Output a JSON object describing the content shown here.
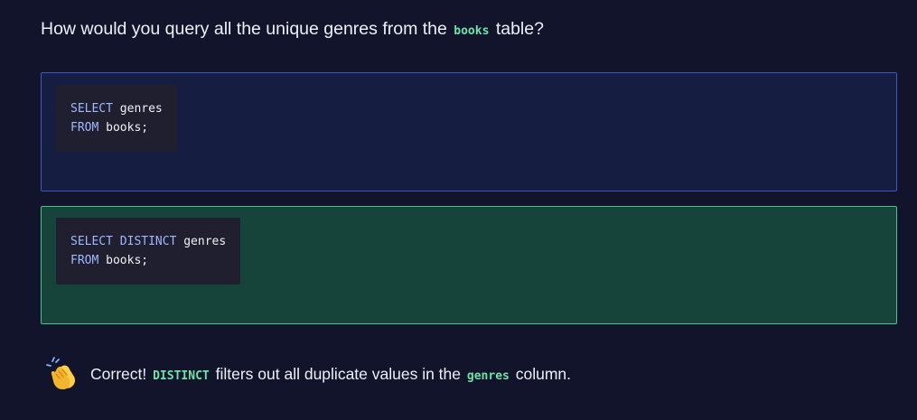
{
  "question": {
    "prefix": "How would you query all the unique genres from the",
    "code": "books",
    "suffix": "table?"
  },
  "options": [
    {
      "line1": {
        "keyword": "SELECT",
        "rest": " genres"
      },
      "line2": {
        "keyword": "FROM",
        "rest": " books;"
      },
      "state": "selected"
    },
    {
      "line1": {
        "keyword": "SELECT DISTINCT",
        "rest": " genres"
      },
      "line2": {
        "keyword": "FROM",
        "rest": " books;"
      },
      "state": "correct"
    }
  ],
  "feedback": {
    "icon": "clapping-hands-icon",
    "lead": "Correct!",
    "code1": "DISTINCT",
    "middle": "filters out all duplicate values in the",
    "code2": "genres",
    "tail": "column."
  },
  "colors": {
    "background": "#11142b",
    "selected_border": "#3b58c9",
    "correct_background": "#17443a",
    "correct_border": "#4ac28a",
    "inline_code": "#6fe3a9",
    "keyword": "#9fb8ff"
  }
}
